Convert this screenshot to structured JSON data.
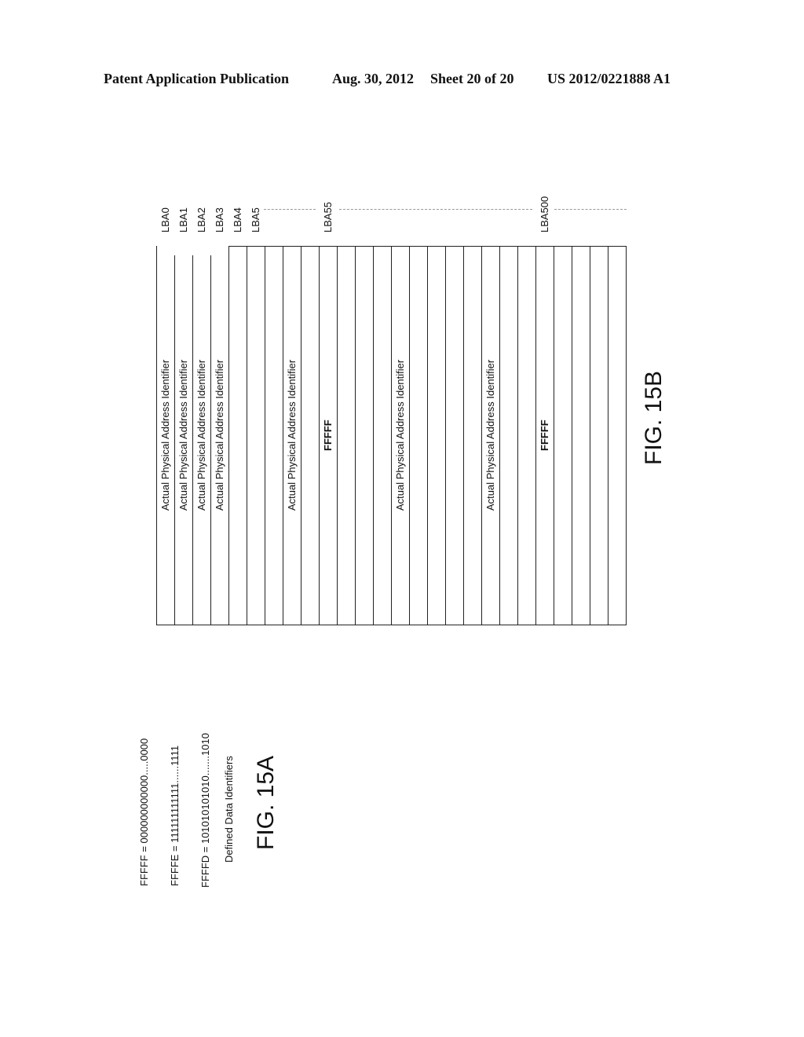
{
  "header": {
    "left": "Patent Application Publication",
    "date": "Aug. 30, 2012",
    "sheet": "Sheet 20 of 20",
    "number": "US 2012/0221888 A1"
  },
  "fig15a": {
    "lines": [
      "FFFFF = 000000000000.....0000",
      "FFFFE = 111111111111......1111",
      "FFFFD = 101010101010.......1010"
    ],
    "caption": "Defined Data Identifiers",
    "label": "FIG. 15A"
  },
  "fig15b": {
    "column_count": 26,
    "lba_labels": [
      {
        "col": 0,
        "text": "LBA0"
      },
      {
        "col": 1,
        "text": "LBA1"
      },
      {
        "col": 2,
        "text": "LBA2"
      },
      {
        "col": 3,
        "text": "LBA3"
      },
      {
        "col": 4,
        "text": "LBA4"
      },
      {
        "col": 5,
        "text": "LBA5"
      },
      {
        "col": 9,
        "text": "LBA55"
      },
      {
        "col": 21,
        "text": "LBA500"
      }
    ],
    "entries": [
      {
        "col": 0,
        "text": "Actual Physical Address Identifier",
        "bold": false
      },
      {
        "col": 1,
        "text": "Actual Physical Address Identifier",
        "bold": false
      },
      {
        "col": 2,
        "text": "Actual Physical Address Identifier",
        "bold": false
      },
      {
        "col": 3,
        "text": "Actual Physical Address Identifier",
        "bold": false
      },
      {
        "col": 7,
        "text": "Actual Physical Address Identifier",
        "bold": false
      },
      {
        "col": 9,
        "text": "FFFFF",
        "bold": true
      },
      {
        "col": 13,
        "text": "Actual Physical Address Identifier",
        "bold": false
      },
      {
        "col": 18,
        "text": "Actual Physical Address Identifier",
        "bold": false
      },
      {
        "col": 21,
        "text": "FFFFF",
        "bold": true
      }
    ],
    "label": "FIG. 15B"
  }
}
